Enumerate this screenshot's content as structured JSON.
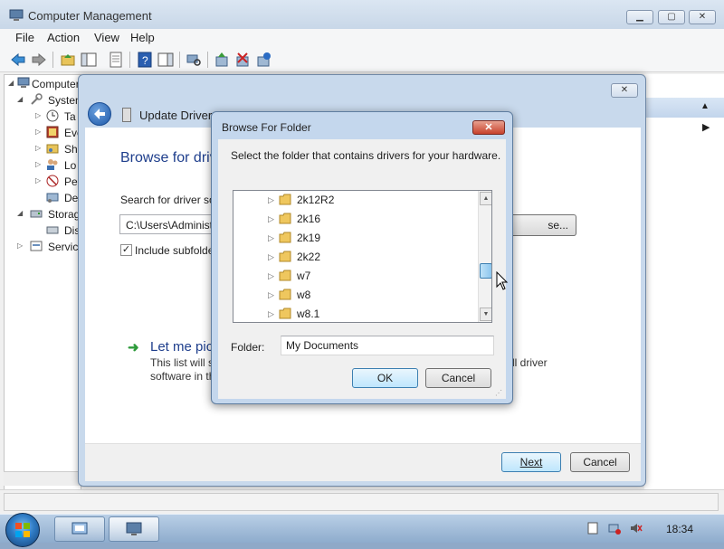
{
  "computer_management": {
    "title": "Computer Management",
    "menu": [
      "File",
      "Action",
      "View",
      "Help"
    ],
    "tree": [
      {
        "label": "Computer",
        "level": 0
      },
      {
        "label": "System",
        "level": 1
      },
      {
        "label": "Ta",
        "level": 2
      },
      {
        "label": "Eve",
        "level": 2
      },
      {
        "label": "Sh",
        "level": 2
      },
      {
        "label": "Lo",
        "level": 2
      },
      {
        "label": "Pe",
        "level": 2
      },
      {
        "label": "De",
        "level": 2
      },
      {
        "label": "Storag",
        "level": 1
      },
      {
        "label": "Dis",
        "level": 2
      },
      {
        "label": "Service",
        "level": 1
      }
    ]
  },
  "wizard": {
    "title": "Update Driver Software - Primary Controller",
    "title_visible": "Update Driver So",
    "heading": "Browse for driv",
    "search_label": "Search for driver so",
    "path_value": "C:\\Users\\Administ",
    "browse_label": "se...",
    "include_subfolders_label": "Include subfolde",
    "include_subfolders_checked": true,
    "pick_label": "Let me pic",
    "pick_desc_line1": "This list will s",
    "pick_desc_line1_tail": "ll driver",
    "pick_desc_line2": "software in th",
    "next_label": "Next",
    "cancel_label": "Cancel"
  },
  "browse_for_folder": {
    "title": "Browse For Folder",
    "close_label": "✕",
    "instruction": "Select the folder that contains drivers for your hardware.",
    "folders": [
      "2k12R2",
      "2k16",
      "2k19",
      "2k22",
      "w7",
      "w8",
      "w8.1"
    ],
    "folder_label": "Folder:",
    "folder_value": "My Documents",
    "ok_label": "OK",
    "cancel_label": "Cancel"
  },
  "taskbar": {
    "clock": "18:34"
  },
  "colors": {
    "heading_blue": "#1e3e8c",
    "default_button_border": "#3c7fb1",
    "close_red": "#c7412c"
  },
  "icons": [
    "back-arrow-icon",
    "forward-arrow-icon",
    "folder-icon",
    "expand-arrow-icon",
    "scroll-up-icon",
    "scroll-down-icon",
    "windows-logo-icon",
    "cursor-icon",
    "clock-icon"
  ]
}
